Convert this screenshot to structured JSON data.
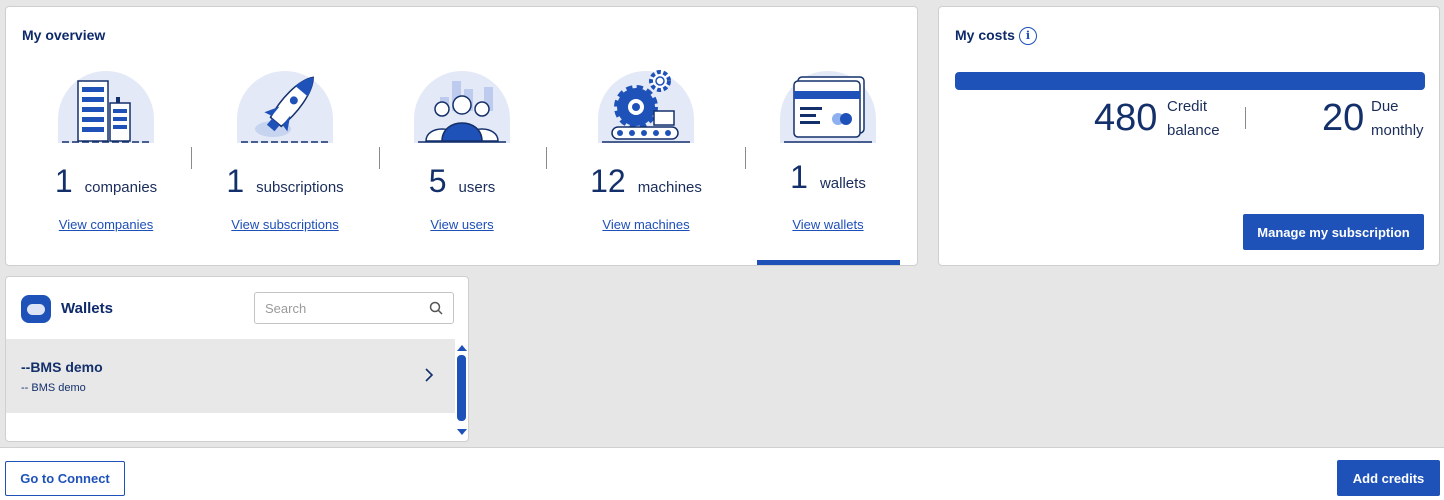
{
  "overview": {
    "title": "My overview",
    "items": [
      {
        "count": "1",
        "label": "companies",
        "link": "View companies",
        "icon": "buildings-icon"
      },
      {
        "count": "1",
        "label": "subscriptions",
        "link": "View subscriptions",
        "icon": "rocket-icon"
      },
      {
        "count": "5",
        "label": "users",
        "link": "View users",
        "icon": "users-icon"
      },
      {
        "count": "12",
        "label": "machines",
        "link": "View machines",
        "icon": "gear-machine-icon"
      },
      {
        "count": "1",
        "label": "wallets",
        "link": "View wallets",
        "icon": "wallet-card-icon"
      }
    ],
    "active_item": "wallets"
  },
  "costs": {
    "title": "My costs",
    "credit_value": "480",
    "credit_label_1": "Credit",
    "credit_label_2": "balance",
    "due_value": "20",
    "due_label_1": "Due",
    "due_label_2": "monthly",
    "manage_button": "Manage my subscription"
  },
  "wallets": {
    "title": "Wallets",
    "search_placeholder": "Search",
    "items": [
      {
        "name": "--BMS demo",
        "subtitle": "-- BMS demo"
      }
    ]
  },
  "footer": {
    "connect_button": "Go to Connect",
    "add_credits_button": "Add credits"
  },
  "colors": {
    "primary": "#1f52b9",
    "text": "#14306b",
    "illustration_bg": "#e3e9f6"
  }
}
